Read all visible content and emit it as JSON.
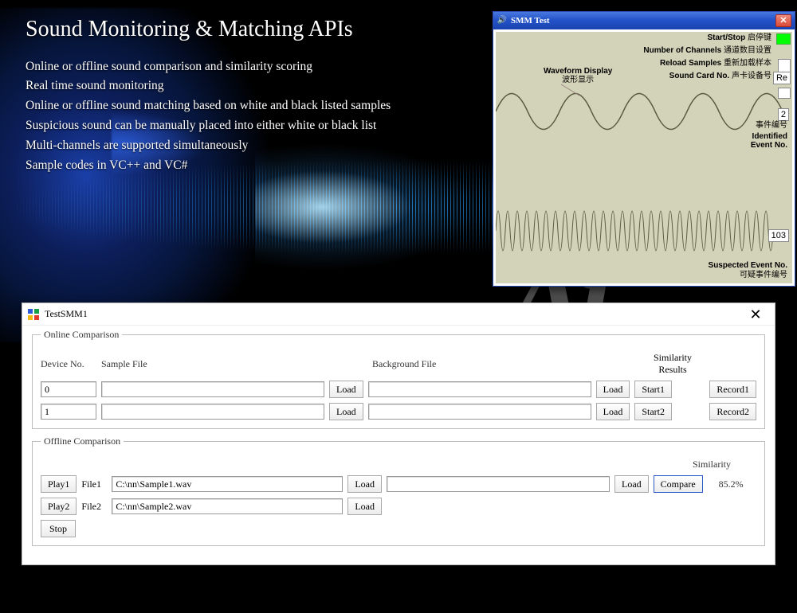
{
  "hero": {
    "title": "Sound Monitoring & Matching APIs",
    "lines": [
      "Online or offline sound comparison and similarity scoring",
      "Real time sound monitoring",
      "Online or offline sound matching based on white and black listed samples",
      "Suspicious sound can be manually placed into either white or black list",
      "Multi-channels are supported simultaneously",
      "Sample codes in VC++ and VC#"
    ]
  },
  "watermark": "Ai",
  "smm": {
    "title": "SMM Test",
    "labels": {
      "start_stop_en": "Start/Stop",
      "start_stop_zh": "启停键",
      "channels_en": "Number of Channels",
      "channels_zh": "通道数目设置",
      "reload_en": "Reload Samples",
      "reload_zh": "重新加载样本",
      "card_en": "Sound Card No.",
      "card_zh": "声卡设备号",
      "waveform_en": "Waveform Display",
      "waveform_zh": "波形显示",
      "identified_en": "Identified\nEvent No.",
      "identified_zh": "事件编号",
      "suspected_en": "Suspected Event No.",
      "suspected_zh": "可疑事件编号"
    },
    "indicator_color": "#00ff00",
    "reload_btn": "Re",
    "identified_value": "2",
    "suspected_value": "103"
  },
  "app": {
    "title": "TestSMM1",
    "online": {
      "legend": "Online Comparison",
      "headers": {
        "device": "Device No.",
        "sample": "Sample File",
        "bg": "Background File",
        "sim": "Similarity",
        "results": "Results"
      },
      "load": "Load",
      "rows": [
        {
          "device": "0",
          "sample": "",
          "bg": "",
          "start": "Start1",
          "record": "Record1"
        },
        {
          "device": "1",
          "sample": "",
          "bg": "",
          "start": "Start2",
          "record": "Record2"
        }
      ]
    },
    "offline": {
      "legend": "Offline Comparison",
      "play1": "Play1",
      "play2": "Play2",
      "stop": "Stop",
      "file1_label": "File1",
      "file2_label": "File2",
      "file1_path": "C:\\nn\\Sample1.wav",
      "file2_path": "C:\\nn\\Sample2.wav",
      "bg_path": "",
      "load": "Load",
      "compare": "Compare",
      "similarity_label": "Similarity",
      "similarity_value": "85.2%"
    }
  }
}
